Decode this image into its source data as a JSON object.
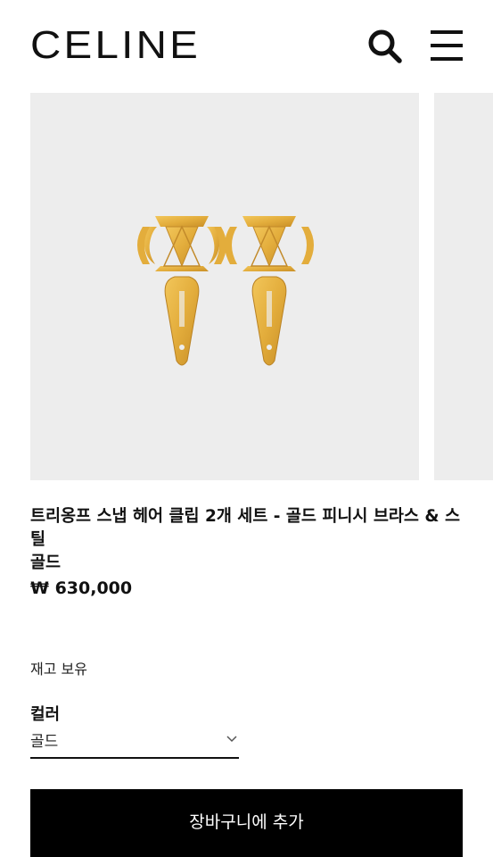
{
  "header": {
    "logo": "CELINE",
    "search_icon": "search-icon",
    "menu_icon": "hamburger-menu-icon"
  },
  "product": {
    "title": "트리옹프 스냅 헤어 클립 2개 세트 - 골드 피니시 브라스 & 스틸",
    "color_name": "골드",
    "price": "₩ 630,000",
    "image_icon": "triomphe-hair-clips-image"
  },
  "availability": {
    "stock_text": "재고 보유"
  },
  "color_selector": {
    "label": "컬러",
    "value": "골드",
    "chevron_icon": "chevron-down-icon"
  },
  "actions": {
    "add_to_cart_label": "장바구니에 추가"
  },
  "colors": {
    "gold": "#e8b84a",
    "gold_dark": "#c9902a",
    "image_bg": "#ededed",
    "button_bg": "#000000"
  }
}
